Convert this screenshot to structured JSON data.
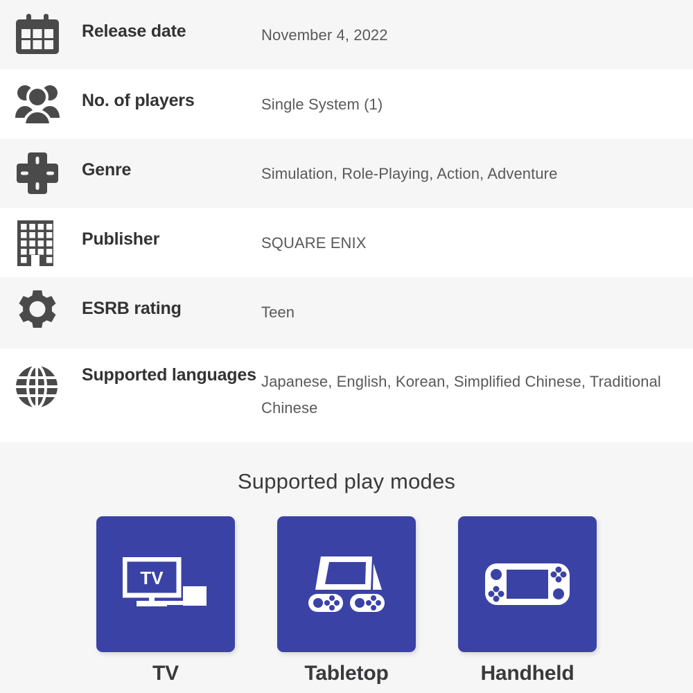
{
  "spec_rows": [
    {
      "icon": "calendar-icon",
      "label": "Release date",
      "value": "November 4, 2022"
    },
    {
      "icon": "players-group-icon",
      "label": "No. of players",
      "value": "Single System (1)"
    },
    {
      "icon": "dpad-icon",
      "label": "Genre",
      "value": "Simulation, Role-Playing, Action, Adventure"
    },
    {
      "icon": "building-icon",
      "label": "Publisher",
      "value": "SQUARE ENIX"
    },
    {
      "icon": "gear-icon",
      "label": "ESRB rating",
      "value": "Teen"
    },
    {
      "icon": "globe-icon",
      "label": "Supported languages",
      "value": "Japanese, English, Korean, Simplified Chinese, Traditional Chinese"
    }
  ],
  "play_modes": {
    "title": "Supported play modes",
    "modes": [
      {
        "icon": "tv-dock-icon",
        "label": "TV",
        "screen_text": "TV"
      },
      {
        "icon": "tabletop-icon",
        "label": "Tabletop"
      },
      {
        "icon": "handheld-icon",
        "label": "Handheld"
      }
    ]
  },
  "colors": {
    "tile_blue": "#3a43a5",
    "row_alt_background": "#f6f6f6",
    "row_background": "#ffffff",
    "label_text": "#333333",
    "value_text": "#58595b",
    "icon_fill": "#4a4a4a"
  }
}
